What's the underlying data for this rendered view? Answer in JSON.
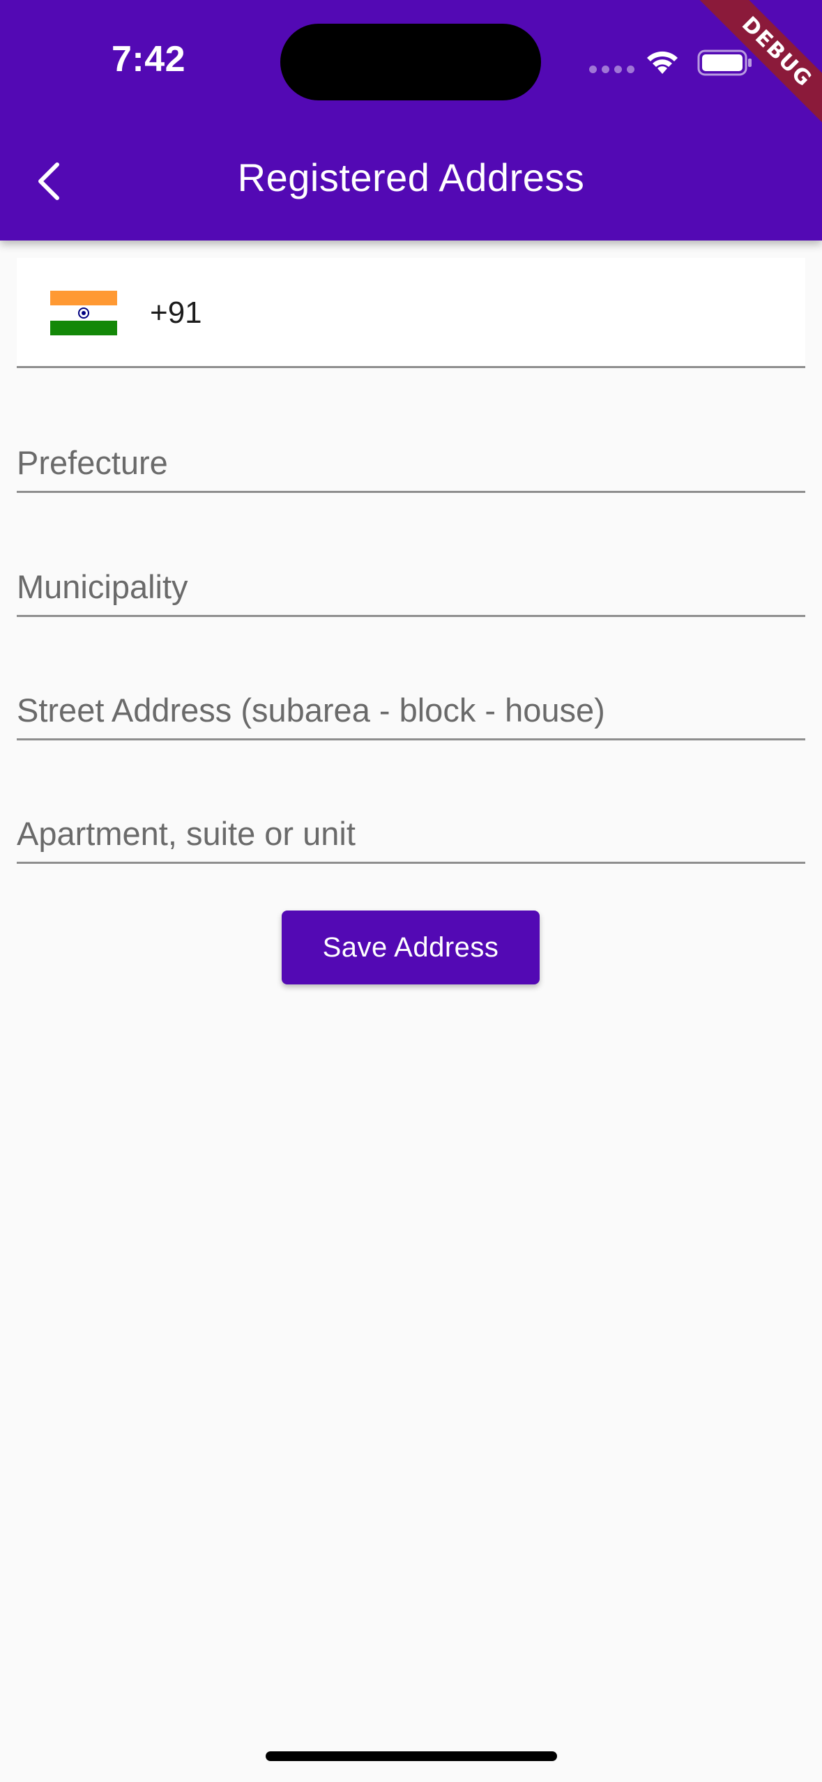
{
  "status_bar": {
    "time": "7:42"
  },
  "debug_banner": {
    "label": "DEBUG"
  },
  "app_bar": {
    "title": "Registered Address",
    "back_icon": "chevron-left-icon"
  },
  "phone": {
    "flag_icon": "india-flag-icon",
    "dial_code": "+91"
  },
  "form": {
    "prefecture_placeholder": "Prefecture",
    "municipality_placeholder": "Municipality",
    "street_placeholder": "Street Address (subarea - block - house)",
    "apartment_placeholder": "Apartment, suite or unit"
  },
  "actions": {
    "save_label": "Save Address"
  },
  "colors": {
    "primary": "#5309b4",
    "background": "#fafafa",
    "debug_ribbon": "#8b1a3a"
  }
}
